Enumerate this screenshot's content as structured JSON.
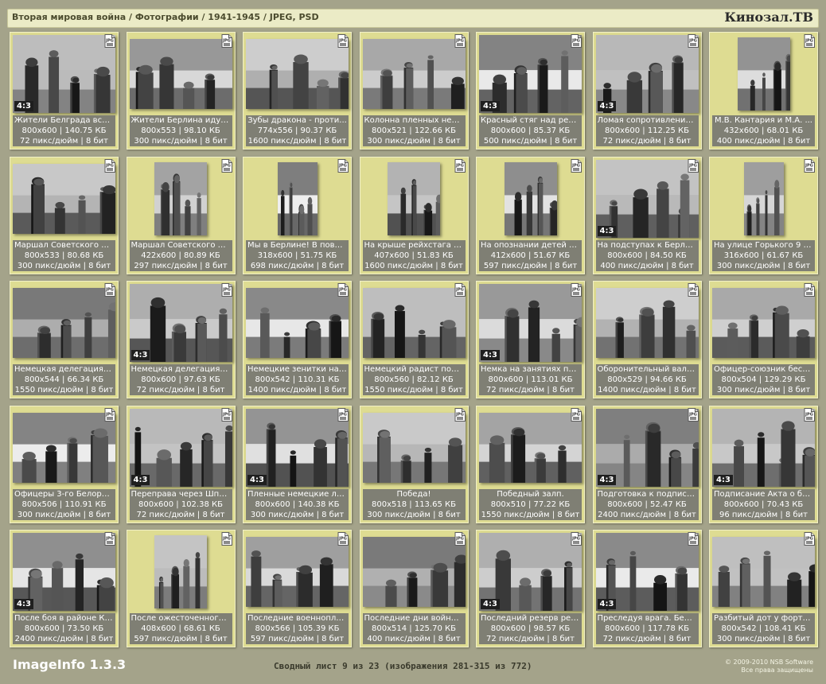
{
  "header": {
    "path": "Вторая мировая война / Фотографии / 1941-1945 / JPEG, PSD",
    "site": "Кинозал.ТВ"
  },
  "file_type_icon": "jpg-file-icon",
  "tiles": [
    {
      "title": "Жители Белграда вст...",
      "dims": "800x600 | 140.75 КБ",
      "meta": "72 пикс/дюйм | 8 бит",
      "ratio": "4:3",
      "orient": "land43"
    },
    {
      "title": "Жители Берлина идут...",
      "dims": "800x553 | 98.10 КБ",
      "meta": "300 пикс/дюйм | 8 бит",
      "ratio": "",
      "orient": "land"
    },
    {
      "title": "Зубы дракона - проти...",
      "dims": "774x556 | 90.37 КБ",
      "meta": "1600 пикс/дюйм | 8 бит",
      "ratio": "",
      "orient": "land"
    },
    {
      "title": "Колонна пленных нем...",
      "dims": "800x521 | 122.66 КБ",
      "meta": "300 пикс/дюйм | 8 бит",
      "ratio": "",
      "orient": "land"
    },
    {
      "title": "Красный стяг над рей...",
      "dims": "800x600 | 85.37 КБ",
      "meta": "500 пикс/дюйм | 8 бит",
      "ratio": "4:3",
      "orient": "land43"
    },
    {
      "title": "Ломая сопротивление ...",
      "dims": "800x600 | 112.25 КБ",
      "meta": "72 пикс/дюйм | 8 бит",
      "ratio": "4:3",
      "orient": "land43"
    },
    {
      "title": "М.В. Кантария и М.А. ...",
      "dims": "432x600 | 68.01 КБ",
      "meta": "400 пикс/дюйм | 8 бит",
      "ratio": "",
      "orient": "port"
    },
    {
      "title": "Маршал Советского С...",
      "dims": "800x533 | 80.68 КБ",
      "meta": "300 пикс/дюйм | 8 бит",
      "ratio": "",
      "orient": "land"
    },
    {
      "title": "Маршал Советского С...",
      "dims": "422x600 | 80.89 КБ",
      "meta": "297 пикс/дюйм | 8 бит",
      "ratio": "",
      "orient": "port"
    },
    {
      "title": "Мы в Берлине! В пове...",
      "dims": "318x600 | 51.75 КБ",
      "meta": "698 пикс/дюйм | 8 бит",
      "ratio": "",
      "orient": "narrow"
    },
    {
      "title": "На крыше рейхстага б...",
      "dims": "407x600 | 51.83 КБ",
      "meta": "1600 пикс/дюйм | 8 бит",
      "ratio": "",
      "orient": "port"
    },
    {
      "title": "На опознании детей Г...",
      "dims": "412x600 | 51.67 КБ",
      "meta": "597 пикс/дюйм | 8 бит",
      "ratio": "",
      "orient": "port"
    },
    {
      "title": "На подступах к Берли...",
      "dims": "800x600 | 84.50 КБ",
      "meta": "400 пикс/дюйм | 8 бит",
      "ratio": "4:3",
      "orient": "land43"
    },
    {
      "title": "На улице Горького 9 м...",
      "dims": "316x600 | 61.67 КБ",
      "meta": "300 пикс/дюйм | 8 бит",
      "ratio": "",
      "orient": "narrow"
    },
    {
      "title": "Немецкая делегация в...",
      "dims": "800x544 | 66.34 КБ",
      "meta": "1550 пикс/дюйм | 8 бит",
      "ratio": "",
      "orient": "land"
    },
    {
      "title": "Немецкая делегация, ...",
      "dims": "800x600 | 97.63 КБ",
      "meta": "72 пикс/дюйм | 8 бит",
      "ratio": "4:3",
      "orient": "land43"
    },
    {
      "title": "Немецкие зенитки на ...",
      "dims": "800x542 | 110.31 КБ",
      "meta": "1400 пикс/дюйм | 8 бит",
      "ratio": "",
      "orient": "land"
    },
    {
      "title": "Немецкий радист под ...",
      "dims": "800x560 | 82.12 КБ",
      "meta": "1550 пикс/дюйм | 8 бит",
      "ratio": "",
      "orient": "land"
    },
    {
      "title": "Немка на занятиях по ...",
      "dims": "800x600 | 113.01 КБ",
      "meta": "72 пикс/дюйм | 8 бит",
      "ratio": "4:3",
      "orient": "land43"
    },
    {
      "title": "Оборонительный вал ...",
      "dims": "800x529 | 94.66 КБ",
      "meta": "1400 пикс/дюйм | 8 бит",
      "ratio": "",
      "orient": "land"
    },
    {
      "title": "Офицер-союзник бесе...",
      "dims": "800x504 | 129.29 КБ",
      "meta": "300 пикс/дюйм | 8 бит",
      "ratio": "",
      "orient": "land"
    },
    {
      "title": "Офицеры 3-го Белору...",
      "dims": "800x506 | 110.91 КБ",
      "meta": "300 пикс/дюйм | 8 бит",
      "ratio": "",
      "orient": "land"
    },
    {
      "title": "Переправа через Шпр...",
      "dims": "800x600 | 102.38 КБ",
      "meta": "72 пикс/дюйм | 8 бит",
      "ratio": "4:3",
      "orient": "land43"
    },
    {
      "title": "Пленные немецкие ле...",
      "dims": "800x600 | 140.38 КБ",
      "meta": "300 пикс/дюйм | 8 бит",
      "ratio": "4:3",
      "orient": "land43"
    },
    {
      "title": "Победа!",
      "dims": "800x518 | 113.65 КБ",
      "meta": "300 пикс/дюйм | 8 бит",
      "ratio": "",
      "orient": "land"
    },
    {
      "title": "Победный залп.",
      "dims": "800x510 | 77.22 КБ",
      "meta": "1550 пикс/дюйм | 8 бит",
      "ratio": "",
      "orient": "land"
    },
    {
      "title": "Подготовка к подписа...",
      "dims": "800x600 | 52.47 КБ",
      "meta": "2400 пикс/дюйм | 8 бит",
      "ratio": "4:3",
      "orient": "land43"
    },
    {
      "title": "Подписание Акта о бе...",
      "dims": "800x600 | 70.43 КБ",
      "meta": "96 пикс/дюйм | 8 бит",
      "ratio": "4:3",
      "orient": "land43"
    },
    {
      "title": "После боя в районе Ке...",
      "dims": "800x600 | 73.50 КБ",
      "meta": "2400 пикс/дюйм | 8 бит",
      "ratio": "4:3",
      "orient": "land43"
    },
    {
      "title": "После ожесточенного ...",
      "dims": "408x600 | 68.61 КБ",
      "meta": "597 пикс/дюйм | 8 бит",
      "ratio": "",
      "orient": "port"
    },
    {
      "title": "Последние военнопле...",
      "dims": "800x566 | 105.39 КБ",
      "meta": "597 пикс/дюйм | 8 бит",
      "ratio": "",
      "orient": "land"
    },
    {
      "title": "Последние дни войны...",
      "dims": "800x514 | 125.70 КБ",
      "meta": "400 пикс/дюйм | 8 бит",
      "ratio": "",
      "orient": "land"
    },
    {
      "title": "Последний резерв рей...",
      "dims": "800x600 | 98.57 КБ",
      "meta": "72 пикс/дюйм | 8 бит",
      "ratio": "4:3",
      "orient": "land43"
    },
    {
      "title": "Преследуя врага. Бер...",
      "dims": "800x600 | 117.78 КБ",
      "meta": "72 пикс/дюйм | 8 бит",
      "ratio": "4:3",
      "orient": "land43"
    },
    {
      "title": "Разбитый дот у форта...",
      "dims": "800x542 | 108.41 КБ",
      "meta": "300 пикс/дюйм | 8 бит",
      "ratio": "",
      "orient": "land"
    }
  ],
  "footer": {
    "app": "ImageInfo 1.3.3",
    "sheet": "Сводный лист 9 из 23 (изображения 281-315 из 772)",
    "copyright_line1": "© 2009-2010 NSB Software",
    "copyright_line2": "Все права защищены"
  },
  "colors": {
    "background": "#a4a38a",
    "tile": "#dedc92",
    "caption": "#7f7f74",
    "header": "#ebebc6"
  }
}
